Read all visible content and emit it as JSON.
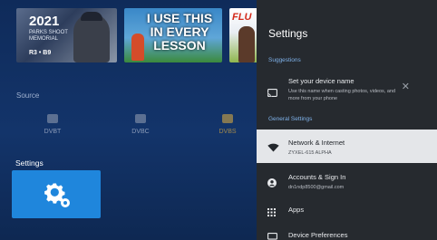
{
  "launcher": {
    "thumbnails": [
      {
        "year": "2021",
        "subtitle": "PARKS SHOOT MEMORIAL",
        "tag": "R3 • B9"
      },
      {
        "text": "I USE THIS IN EVERY LESSON"
      },
      {
        "text": "FLU"
      }
    ],
    "source_label": "Source",
    "sources": [
      "DVBT",
      "DVBC",
      "DVBS"
    ],
    "settings_label": "Settings"
  },
  "panel": {
    "title": "Settings",
    "section_suggestions": "Suggestions",
    "suggestion": {
      "title": "Set your device name",
      "description": "Use this name when casting photos, videos, and more from your phone"
    },
    "section_general": "General Settings",
    "items": [
      {
        "title": "Network & Internet",
        "subtitle": "ZYXEL-615 ALPHA",
        "icon": "wifi-icon"
      },
      {
        "title": "Accounts & Sign In",
        "subtitle": "dn1ndp8500@gmail.com",
        "icon": "account-icon"
      },
      {
        "title": "Apps",
        "icon": "apps-grid-icon"
      },
      {
        "title": "Device Preferences",
        "icon": "tv-icon"
      }
    ]
  },
  "colors": {
    "tile_accent": "#1f86dc",
    "section_header": "#7fb2ea",
    "panel_bg": "#262a2f",
    "selected_row": "#e4e6e9"
  }
}
